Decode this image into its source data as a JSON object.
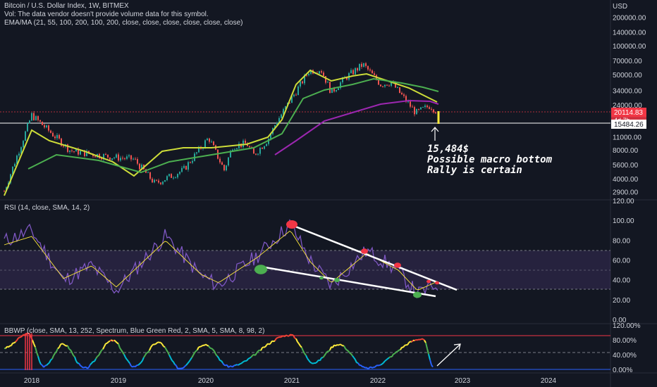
{
  "header": {
    "title": "Bitcoin / U.S. Dollar Index, 1W, BITMEX",
    "vol_note": "Vol: The data vendor doesn't provide volume data for this symbol.",
    "ema_label": "EMA/MA (21, 55, 100, 200, 100, 200, close, close, close, close, close, close)"
  },
  "price_axis": {
    "currency": "USD",
    "ticks": [
      "200000.00",
      "140000.00",
      "100000.00",
      "70000.00",
      "50000.00",
      "34000.00",
      "24000.00",
      "11000.00",
      "8000.00",
      "5600.00",
      "4000.00",
      "2900.00"
    ],
    "tick_values": [
      200000,
      140000,
      100000,
      70000,
      50000,
      34000,
      24000,
      11000,
      8000,
      5600,
      4000,
      2900
    ],
    "last_price": "20114.83",
    "countdown": "4d 7h",
    "line_price": "15484.26",
    "last_price_color": "#f23645"
  },
  "annotation": {
    "line1": "15,484$",
    "line2": "Possible macro bottom",
    "line3": "Rally is certain"
  },
  "rsi": {
    "label": "RSI (14, close, SMA, 14, 2)",
    "ticks": [
      "120.00",
      "100.00",
      "80.00",
      "60.00",
      "40.00",
      "20.00",
      "0.00"
    ],
    "tick_values": [
      120,
      100,
      80,
      60,
      40,
      20,
      0
    ]
  },
  "bbwp": {
    "label": "BBWP (close, SMA, 13, 252, Spectrum, Blue Green Red, 2, SMA, 5, SMA, 8, 98, 2)",
    "ticks": [
      "120.00%",
      "80.00%",
      "40.00%",
      "0.00%"
    ],
    "tick_values": [
      120,
      80,
      40,
      0
    ]
  },
  "time_axis": {
    "labels": [
      "2018",
      "2019",
      "2020",
      "2021",
      "2022",
      "2023",
      "2024"
    ]
  },
  "chart_data": [
    {
      "type": "line",
      "title": "Bitcoin / U.S. Dollar Index, 1W, BITMEX",
      "scale": "log",
      "x": [
        "2017-11",
        "2018-01",
        "2018-04",
        "2018-07",
        "2018-10",
        "2018-12",
        "2019-04",
        "2019-06",
        "2019-09",
        "2019-12",
        "2020-03",
        "2020-06",
        "2020-09",
        "2020-11",
        "2021-01",
        "2021-02",
        "2021-04",
        "2021-07",
        "2021-09",
        "2021-11",
        "2022-01",
        "2022-04",
        "2022-06",
        "2022-08",
        "2022-09"
      ],
      "series": [
        {
          "values": [
            3000,
            19000,
            8000,
            7000,
            6500,
            3600,
            5000,
            11000,
            9000,
            7200,
            5000,
            9500,
            10500,
            16000,
            32000,
            55000,
            58000,
            33000,
            47000,
            65000,
            40000,
            42000,
            20000,
            24000,
            20114
          ]
        }
      ],
      "ylim": [
        2500,
        250000
      ]
    },
    {
      "type": "line",
      "title": "RSI (14, close, SMA, 14, 2)",
      "x": [
        "2017-11",
        "2018-01",
        "2018-04",
        "2018-07",
        "2018-12",
        "2019-06",
        "2019-12",
        "2020-03",
        "2020-08",
        "2021-01",
        "2021-04",
        "2021-07",
        "2021-11",
        "2022-04",
        "2022-06",
        "2022-09"
      ],
      "series": [
        {
          "values": [
            80,
            90,
            40,
            55,
            30,
            85,
            45,
            35,
            65,
            97,
            60,
            35,
            70,
            50,
            26,
            37
          ]
        }
      ],
      "ylim": [
        0,
        120
      ]
    },
    {
      "type": "line",
      "title": "BBWP (close, SMA, 13, 252, Spectrum, Blue Green Red, 2, SMA, 5, SMA, 8, 98, 2)",
      "series": [
        {
          "values": [
            60,
            98,
            10,
            70,
            5,
            80,
            10,
            75,
            5,
            70,
            10,
            95,
            20,
            70,
            5,
            85,
            5
          ]
        }
      ],
      "ylim": [
        0,
        120
      ]
    }
  ]
}
